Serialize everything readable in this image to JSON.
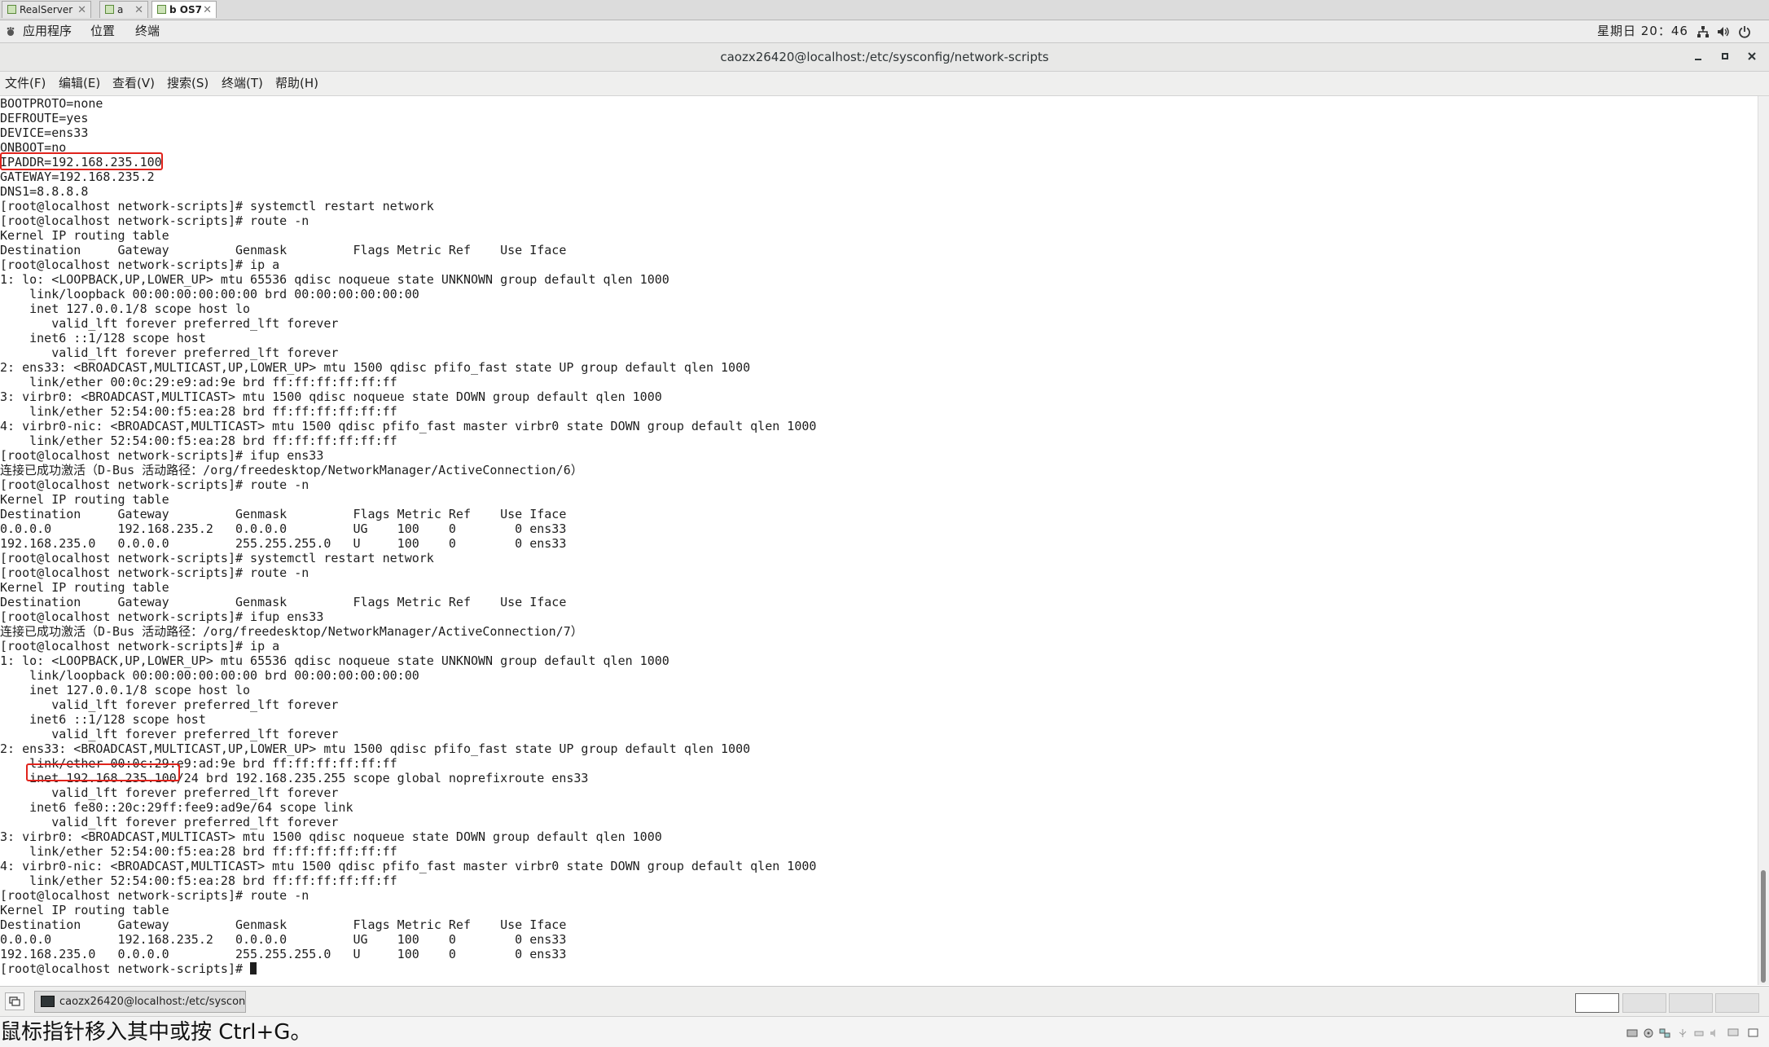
{
  "vm_tabs": [
    {
      "label": "RealServer",
      "active": false
    },
    {
      "label": "a",
      "active": false
    },
    {
      "label": "b OS7",
      "active": true
    }
  ],
  "topbar": {
    "applications": "应用程序",
    "places": "位置",
    "terminal": "终端",
    "clock": "星期日 20：46"
  },
  "window": {
    "title": "caozx26420@localhost:/etc/sysconfig/network-scripts"
  },
  "menu": {
    "file": "文件(F)",
    "edit": "编辑(E)",
    "view": "查看(V)",
    "search": "搜索(S)",
    "terminal": "终端(T)",
    "help": "帮助(H)"
  },
  "terminal": {
    "lines": [
      "BOOTPROTO=none",
      "DEFROUTE=yes",
      "DEVICE=ens33",
      "ONBOOT=no",
      "IPADDR=192.168.235.100",
      "GATEWAY=192.168.235.2",
      "DNS1=8.8.8.8",
      "[root@localhost network-scripts]# systemctl restart network",
      "[root@localhost network-scripts]# route -n",
      "Kernel IP routing table",
      "Destination     Gateway         Genmask         Flags Metric Ref    Use Iface",
      "[root@localhost network-scripts]# ip a",
      "1: lo: <LOOPBACK,UP,LOWER_UP> mtu 65536 qdisc noqueue state UNKNOWN group default qlen 1000",
      "    link/loopback 00:00:00:00:00:00 brd 00:00:00:00:00:00",
      "    inet 127.0.0.1/8 scope host lo",
      "       valid_lft forever preferred_lft forever",
      "    inet6 ::1/128 scope host",
      "       valid_lft forever preferred_lft forever",
      "2: ens33: <BROADCAST,MULTICAST,UP,LOWER_UP> mtu 1500 qdisc pfifo_fast state UP group default qlen 1000",
      "    link/ether 00:0c:29:e9:ad:9e brd ff:ff:ff:ff:ff:ff",
      "3: virbr0: <BROADCAST,MULTICAST> mtu 1500 qdisc noqueue state DOWN group default qlen 1000",
      "    link/ether 52:54:00:f5:ea:28 brd ff:ff:ff:ff:ff:ff",
      "4: virbr0-nic: <BROADCAST,MULTICAST> mtu 1500 qdisc pfifo_fast master virbr0 state DOWN group default qlen 1000",
      "    link/ether 52:54:00:f5:ea:28 brd ff:ff:ff:ff:ff:ff",
      "[root@localhost network-scripts]# ifup ens33",
      "连接已成功激活（D-Bus 活动路径：/org/freedesktop/NetworkManager/ActiveConnection/6）",
      "[root@localhost network-scripts]# route -n",
      "Kernel IP routing table",
      "Destination     Gateway         Genmask         Flags Metric Ref    Use Iface",
      "0.0.0.0         192.168.235.2   0.0.0.0         UG    100    0        0 ens33",
      "192.168.235.0   0.0.0.0         255.255.255.0   U     100    0        0 ens33",
      "[root@localhost network-scripts]# systemctl restart network",
      "[root@localhost network-scripts]# route -n",
      "Kernel IP routing table",
      "Destination     Gateway         Genmask         Flags Metric Ref    Use Iface",
      "[root@localhost network-scripts]# ifup ens33",
      "连接已成功激活（D-Bus 活动路径：/org/freedesktop/NetworkManager/ActiveConnection/7）",
      "[root@localhost network-scripts]# ip a",
      "1: lo: <LOOPBACK,UP,LOWER_UP> mtu 65536 qdisc noqueue state UNKNOWN group default qlen 1000",
      "    link/loopback 00:00:00:00:00:00 brd 00:00:00:00:00:00",
      "    inet 127.0.0.1/8 scope host lo",
      "       valid_lft forever preferred_lft forever",
      "    inet6 ::1/128 scope host",
      "       valid_lft forever preferred_lft forever",
      "2: ens33: <BROADCAST,MULTICAST,UP,LOWER_UP> mtu 1500 qdisc pfifo_fast state UP group default qlen 1000",
      "    link/ether 00:0c:29:e9:ad:9e brd ff:ff:ff:ff:ff:ff",
      "    inet 192.168.235.100/24 brd 192.168.235.255 scope global noprefixroute ens33",
      "       valid_lft forever preferred_lft forever",
      "    inet6 fe80::20c:29ff:fee9:ad9e/64 scope link",
      "       valid_lft forever preferred_lft forever",
      "3: virbr0: <BROADCAST,MULTICAST> mtu 1500 qdisc noqueue state DOWN group default qlen 1000",
      "    link/ether 52:54:00:f5:ea:28 brd ff:ff:ff:ff:ff:ff",
      "4: virbr0-nic: <BROADCAST,MULTICAST> mtu 1500 qdisc pfifo_fast master virbr0 state DOWN group default qlen 1000",
      "    link/ether 52:54:00:f5:ea:28 brd ff:ff:ff:ff:ff:ff",
      "[root@localhost network-scripts]# route -n",
      "Kernel IP routing table",
      "Destination     Gateway         Genmask         Flags Metric Ref    Use Iface",
      "0.0.0.0         192.168.235.2   0.0.0.0         UG    100    0        0 ens33",
      "192.168.235.0   0.0.0.0         255.255.255.0   U     100    0        0 ens33",
      "[root@localhost network-scripts]# "
    ]
  },
  "taskbar": {
    "task_label": "caozx26420@localhost:/etc/syscon…"
  },
  "status": {
    "message": "鼠标指针移入其中或按 Ctrl+G。"
  },
  "colors": {
    "highlight": "#e0231c",
    "terminal_bg": "#ffffff",
    "terminal_fg": "#1e1e1e"
  }
}
